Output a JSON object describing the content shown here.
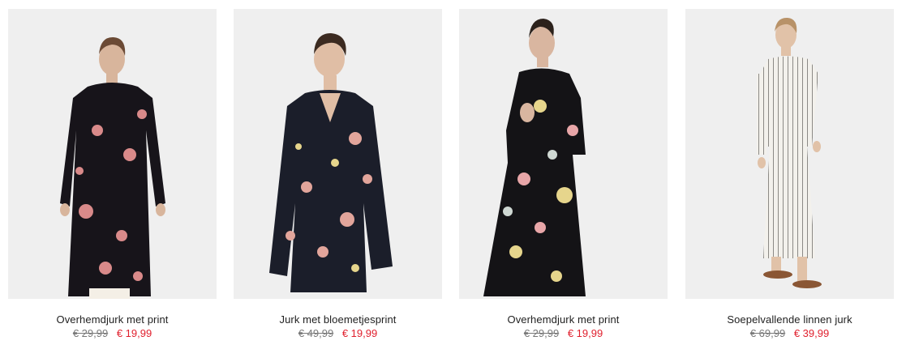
{
  "products": [
    {
      "name": "Overhemdjurk met print",
      "old_price": "€ 29,99",
      "new_price": "€ 19,99",
      "image": "model-in-black-floral-shirt-dress",
      "dress_color": "#17141a",
      "print_color": "#d98a8a"
    },
    {
      "name": "Jurk met bloemetjesprint",
      "old_price": "€ 49,99",
      "new_price": "€ 19,99",
      "image": "model-in-navy-floral-v-neck-dress",
      "dress_color": "#1b1e2a",
      "print_color": "#e2a59b"
    },
    {
      "name": "Overhemdjurk met print",
      "old_price": "€ 29,99",
      "new_price": "€ 19,99",
      "image": "model-in-black-botanical-print-dress",
      "dress_color": "#141316",
      "print_color": "#e6d58c"
    },
    {
      "name": "Soepelvallende linnen jurk",
      "old_price": "€ 69,99",
      "new_price": "€ 39,99",
      "image": "model-in-white-striped-linen-dress",
      "dress_color": "#f3f1ec",
      "print_color": "#8c8a86"
    }
  ],
  "colors": {
    "sale_red": "#e01f2d",
    "photo_background": "#efefef"
  }
}
